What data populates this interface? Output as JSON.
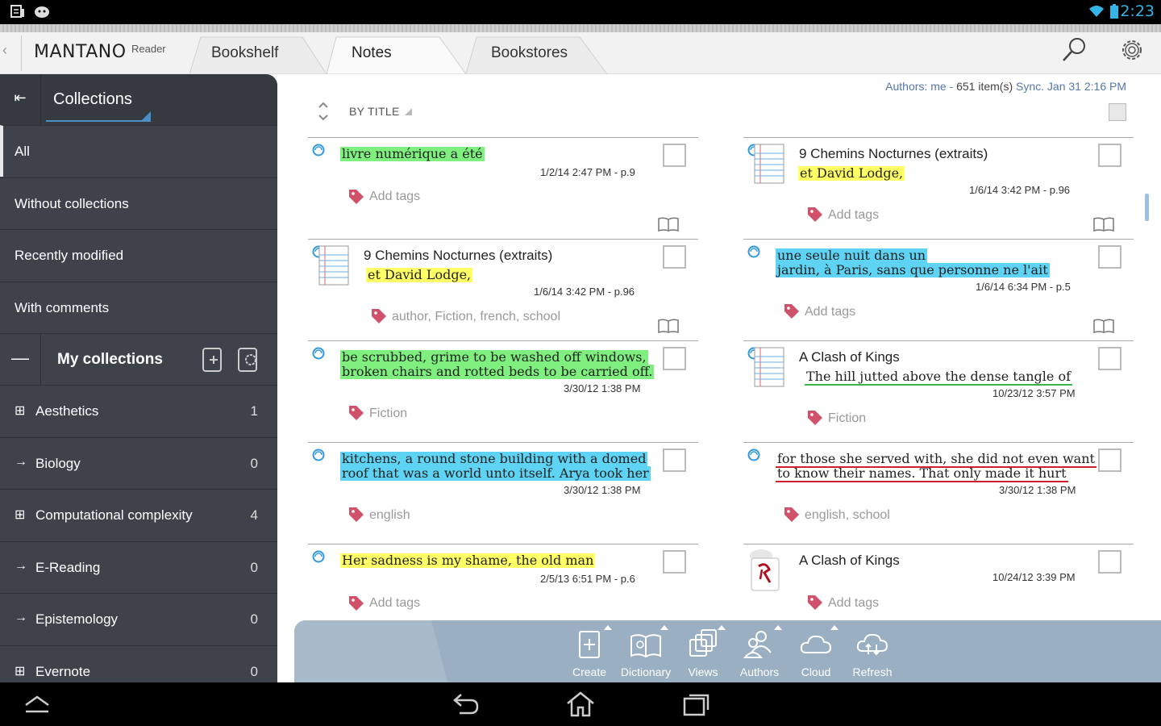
{
  "status": {
    "time": "2:23"
  },
  "app": {
    "logo": "MANTANO",
    "logo_sub": "Reader",
    "tabs": [
      "Bookshelf",
      "Notes",
      "Bookstores"
    ]
  },
  "sidebar": {
    "title": "Collections",
    "items": [
      "All",
      "Without collections",
      "Recently modified",
      "With comments"
    ],
    "my_collections_label": "My collections",
    "collections": [
      {
        "label": "Aesthetics",
        "count": "1",
        "prefix": "⊞"
      },
      {
        "label": "Biology",
        "count": "0",
        "prefix": "→"
      },
      {
        "label": "Computational complexity",
        "count": "4",
        "prefix": "⊞"
      },
      {
        "label": "E-Reading",
        "count": "0",
        "prefix": "→"
      },
      {
        "label": "Epistemology",
        "count": "0",
        "prefix": "→"
      },
      {
        "label": "Evernote",
        "count": "0",
        "prefix": "⊞"
      }
    ]
  },
  "main": {
    "meta": {
      "authors": "Authors: me",
      "sep": " - ",
      "items": "651 item(s)",
      "sync": " Sync. Jan 31 2:16 PM"
    },
    "sort_label": "BY TITLE",
    "left_notes": [
      {
        "quote1": "livre numérique a été",
        "quote2": "",
        "date": "1/2/14 2:47 PM  -  p.9",
        "tags": "Add tags"
      },
      {
        "title": "9 Chemins Nocturnes (extraits)",
        "quote1": "et David Lodge,",
        "date": "1/6/14 3:42 PM  -  p.96",
        "tags": "author, Fiction, french, school"
      },
      {
        "quote1": "be scrubbed, grime to be washed off windows,",
        "quote2": "broken chairs and rotted beds to be carried off.",
        "date": "3/30/12 1:38 PM",
        "tags": "Fiction"
      },
      {
        "quote1": "kitchens, a round stone building with a domed",
        "quote2": "roof that was a world unto itself. Arya took her",
        "date": "3/30/12 1:38 PM",
        "tags": "english"
      },
      {
        "quote1": "Her sadness is my shame, the old man",
        "date": "2/5/13 6:51 PM  -  p.6",
        "tags": "Add tags"
      }
    ],
    "right_notes": [
      {
        "title": "9 Chemins Nocturnes (extraits)",
        "quote1": "et David Lodge,",
        "date": "1/6/14 3:42 PM  -  p.96",
        "tags": "Add tags"
      },
      {
        "quote1": "une seule nuit dans un",
        "quote2": "jardin, à Paris, sans que personne ne l'ait",
        "date": "1/6/14 6:34 PM  -  p.5",
        "tags": "Add tags"
      },
      {
        "title": "A Clash of Kings",
        "quote1": "The hill jutted above the dense tangle of",
        "date": "10/23/12 3:57 PM",
        "tags": "Fiction"
      },
      {
        "quote1": "for those she served with, she did not even want",
        "quote2": "to know their names. That only made it hurt",
        "date": "3/30/12 1:38 PM",
        "tags": "english, school"
      },
      {
        "title": "A Clash of Kings",
        "date": "10/24/12 3:39 PM",
        "tags": "Add tags"
      }
    ]
  },
  "toolbar": {
    "buttons": [
      "Create",
      "Dictionary",
      "Views",
      "Authors",
      "Cloud",
      "Refresh"
    ]
  },
  "colors": {
    "accent": "#33b5e5",
    "sidebar": "#3e434b",
    "toolbar": "#9ab0c2",
    "tag": "#d0526a",
    "hl_green": "#7ff07f",
    "hl_yellow": "#ffff66",
    "hl_cyan": "#5fd3f3"
  }
}
